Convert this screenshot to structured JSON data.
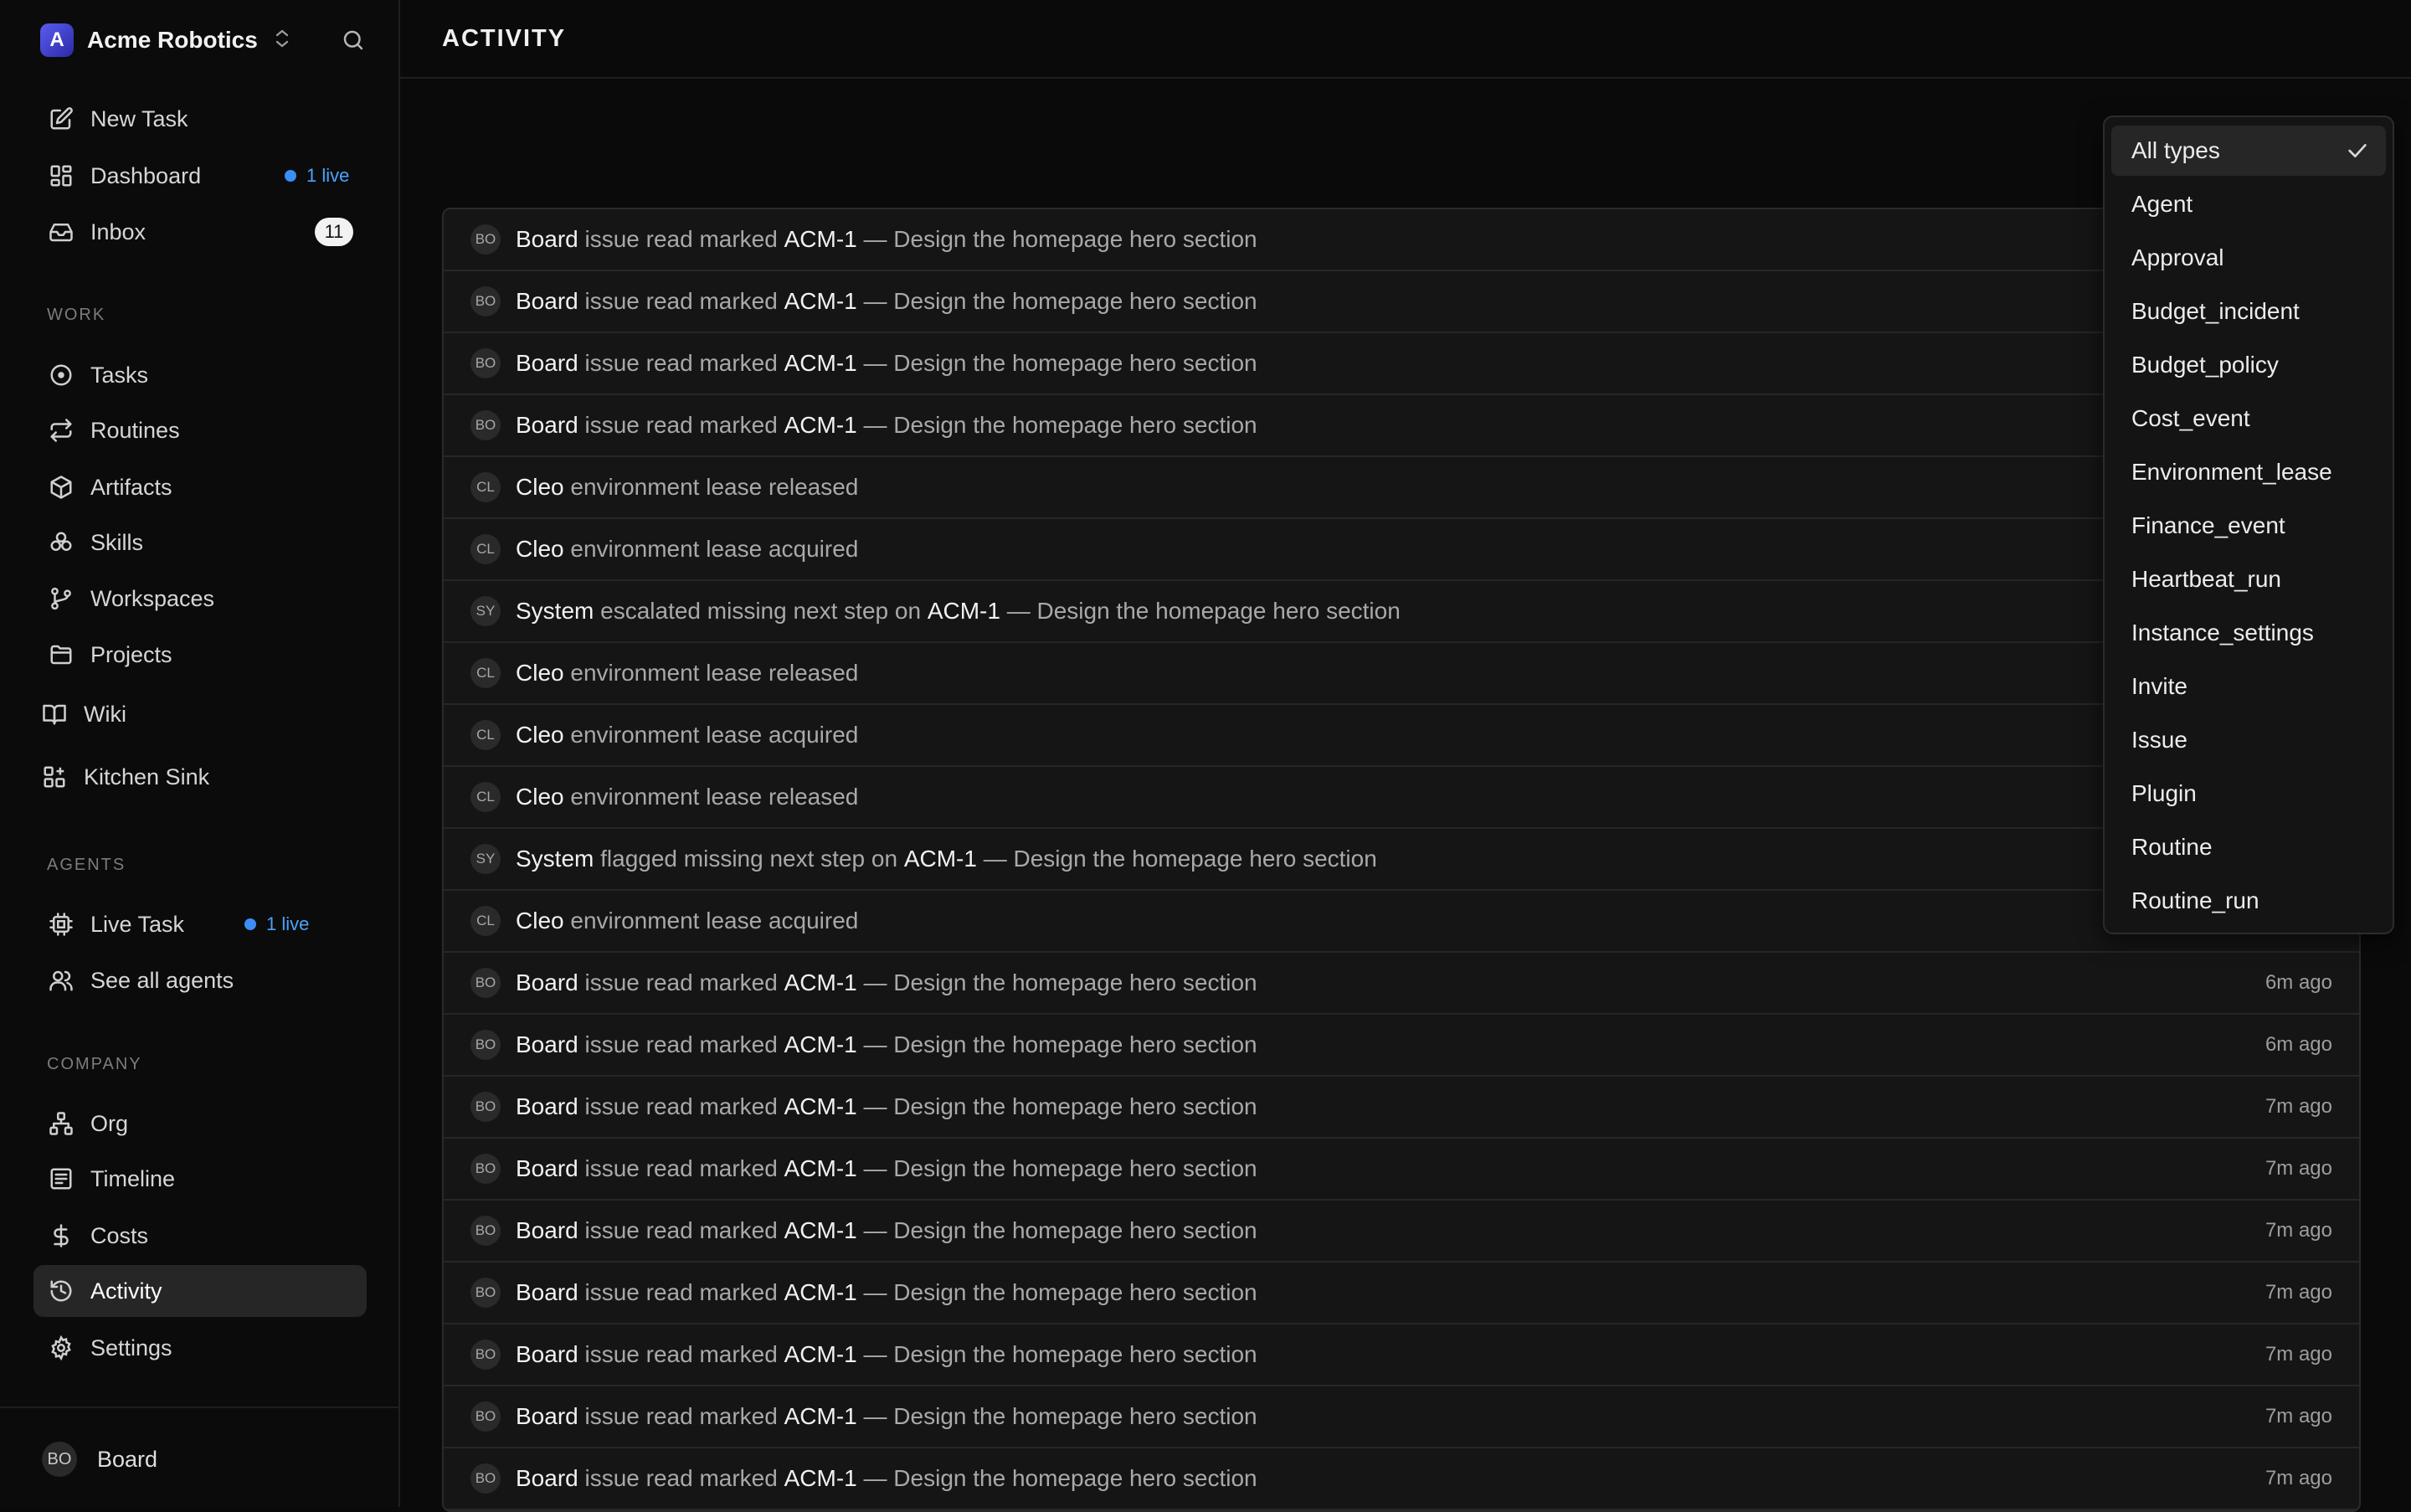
{
  "brand": {
    "logo_letter": "A",
    "name": "Acme Robotics"
  },
  "nav": {
    "top": [
      {
        "label": "New Task",
        "icon": "pencil-square-icon"
      },
      {
        "label": "Dashboard",
        "icon": "dashboard-grid-icon",
        "live": "1 live"
      },
      {
        "label": "Inbox",
        "icon": "inbox-icon",
        "badge": "11"
      }
    ],
    "work_label": "WORK",
    "work": [
      {
        "label": "Tasks",
        "icon": "circle-dot-icon"
      },
      {
        "label": "Routines",
        "icon": "repeat-icon"
      },
      {
        "label": "Artifacts",
        "icon": "package-icon"
      },
      {
        "label": "Skills",
        "icon": "skills-icon"
      },
      {
        "label": "Workspaces",
        "icon": "git-branch-icon"
      },
      {
        "label": "Projects",
        "icon": "folder-icon"
      },
      {
        "label": "Wiki",
        "icon": "book-icon"
      },
      {
        "label": "Kitchen Sink",
        "icon": "component-grid-icon"
      }
    ],
    "agents_label": "AGENTS",
    "agents": [
      {
        "label": "Live Task",
        "icon": "cpu-icon",
        "live": "1 live"
      },
      {
        "label": "See all agents",
        "icon": "users-icon"
      }
    ],
    "company_label": "COMPANY",
    "company": [
      {
        "label": "Org",
        "icon": "org-chart-icon"
      },
      {
        "label": "Timeline",
        "icon": "list-icon"
      },
      {
        "label": "Costs",
        "icon": "dollar-icon"
      },
      {
        "label": "Activity",
        "icon": "history-icon",
        "active": true
      },
      {
        "label": "Settings",
        "icon": "gear-icon"
      }
    ]
  },
  "user": {
    "initials": "BO",
    "name": "Board"
  },
  "page": {
    "title": "ACTIVITY"
  },
  "activity": [
    {
      "initials": "BO",
      "actor": "Board",
      "action": "issue read marked",
      "ref": "ACM-1",
      "detail": "— Design the homepage hero section",
      "time": ""
    },
    {
      "initials": "BO",
      "actor": "Board",
      "action": "issue read marked",
      "ref": "ACM-1",
      "detail": "— Design the homepage hero section",
      "time": ""
    },
    {
      "initials": "BO",
      "actor": "Board",
      "action": "issue read marked",
      "ref": "ACM-1",
      "detail": "— Design the homepage hero section",
      "time": ""
    },
    {
      "initials": "BO",
      "actor": "Board",
      "action": "issue read marked",
      "ref": "ACM-1",
      "detail": "— Design the homepage hero section",
      "time": ""
    },
    {
      "initials": "CL",
      "actor": "Cleo",
      "action": "environment lease released",
      "ref": "",
      "detail": "",
      "time": ""
    },
    {
      "initials": "CL",
      "actor": "Cleo",
      "action": "environment lease acquired",
      "ref": "",
      "detail": "",
      "time": ""
    },
    {
      "initials": "SY",
      "actor": "System",
      "action": "escalated missing next step on",
      "ref": "ACM-1",
      "detail": "— Design the homepage hero section",
      "time": ""
    },
    {
      "initials": "CL",
      "actor": "Cleo",
      "action": "environment lease released",
      "ref": "",
      "detail": "",
      "time": ""
    },
    {
      "initials": "CL",
      "actor": "Cleo",
      "action": "environment lease acquired",
      "ref": "",
      "detail": "",
      "time": ""
    },
    {
      "initials": "CL",
      "actor": "Cleo",
      "action": "environment lease released",
      "ref": "",
      "detail": "",
      "time": ""
    },
    {
      "initials": "SY",
      "actor": "System",
      "action": "flagged missing next step on",
      "ref": "ACM-1",
      "detail": "— Design the homepage hero section",
      "time": ""
    },
    {
      "initials": "CL",
      "actor": "Cleo",
      "action": "environment lease acquired",
      "ref": "",
      "detail": "",
      "time": ""
    },
    {
      "initials": "BO",
      "actor": "Board",
      "action": "issue read marked",
      "ref": "ACM-1",
      "detail": "— Design the homepage hero section",
      "time": "6m ago"
    },
    {
      "initials": "BO",
      "actor": "Board",
      "action": "issue read marked",
      "ref": "ACM-1",
      "detail": "— Design the homepage hero section",
      "time": "6m ago"
    },
    {
      "initials": "BO",
      "actor": "Board",
      "action": "issue read marked",
      "ref": "ACM-1",
      "detail": "— Design the homepage hero section",
      "time": "7m ago"
    },
    {
      "initials": "BO",
      "actor": "Board",
      "action": "issue read marked",
      "ref": "ACM-1",
      "detail": "— Design the homepage hero section",
      "time": "7m ago"
    },
    {
      "initials": "BO",
      "actor": "Board",
      "action": "issue read marked",
      "ref": "ACM-1",
      "detail": "— Design the homepage hero section",
      "time": "7m ago"
    },
    {
      "initials": "BO",
      "actor": "Board",
      "action": "issue read marked",
      "ref": "ACM-1",
      "detail": "— Design the homepage hero section",
      "time": "7m ago"
    },
    {
      "initials": "BO",
      "actor": "Board",
      "action": "issue read marked",
      "ref": "ACM-1",
      "detail": "— Design the homepage hero section",
      "time": "7m ago"
    },
    {
      "initials": "BO",
      "actor": "Board",
      "action": "issue read marked",
      "ref": "ACM-1",
      "detail": "— Design the homepage hero section",
      "time": "7m ago"
    },
    {
      "initials": "BO",
      "actor": "Board",
      "action": "issue read marked",
      "ref": "ACM-1",
      "detail": "— Design the homepage hero section",
      "time": "7m ago"
    }
  ],
  "type_filter": {
    "selected": "All types",
    "options": [
      "All types",
      "Agent",
      "Approval",
      "Budget_incident",
      "Budget_policy",
      "Cost_event",
      "Environment_lease",
      "Finance_event",
      "Heartbeat_run",
      "Instance_settings",
      "Invite",
      "Issue",
      "Plugin",
      "Routine",
      "Routine_run"
    ]
  }
}
